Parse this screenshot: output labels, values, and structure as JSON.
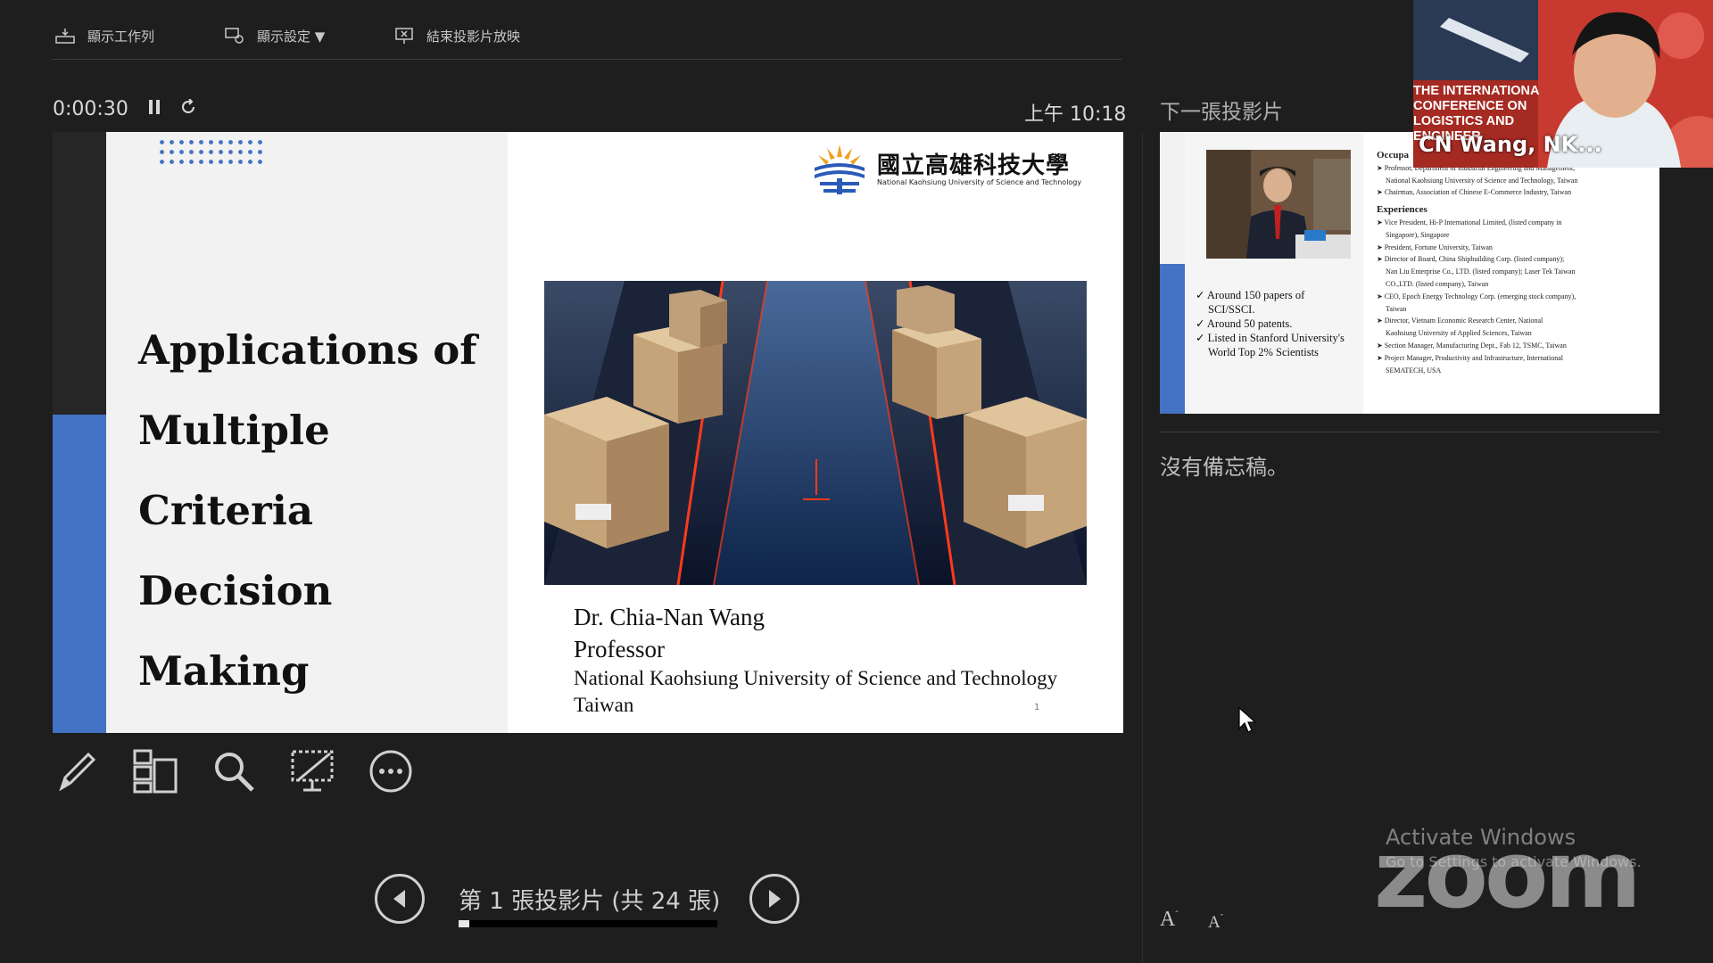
{
  "toolbar": {
    "show_taskbar": "顯示工作列",
    "display_settings": "顯示設定 ▼",
    "end_slideshow": "結束投影片放映"
  },
  "timer": {
    "elapsed": "0:00:30",
    "clock": "上午 10:18"
  },
  "next_slide_label": "下一張投影片",
  "current_slide": {
    "title_lines": [
      "Applications of",
      "Multiple Criteria",
      "Decision Making"
    ],
    "logo_zh": "國立高雄科技大學",
    "logo_en": "National Kaohsiung University of Science and Technology",
    "author": "Dr. Chia-Nan Wang",
    "position": "Professor",
    "university": "National Kaohsiung University of Science and Technology",
    "country": "Taiwan",
    "page": "1"
  },
  "next_slide": {
    "bullets": [
      "✓ Around 150 papers of",
      "SCI/SSCI.",
      "✓ Around 50 patents.",
      "✓ Listed in Stanford University's",
      "World Top 2% Scientists"
    ],
    "occupation_heading": "Occupa",
    "occupation_items": [
      "➤ Professor, Department of Industrial Engineering and Management,",
      "National Kaohsiung University of Science and Technology, Taiwan",
      "➤ Chairman, Association of Chinese E-Commerce Industry, Taiwan"
    ],
    "experiences_heading": "Experiences",
    "experience_items": [
      "➤ Vice President, Hi-P International Limited, (listed company in",
      "Singapore), Singapore",
      "➤ President, Fortune University, Taiwan",
      "➤ Director of Board, China Shipbuilding Corp. (listed company);",
      "Nan Liu Enterprise Co., LTD. (listed company); Laser Tek Taiwan",
      "CO.,LTD. (listed company), Taiwan",
      "➤ CEO, Epoch Energy Technology Corp. (emerging stock company),",
      "Taiwan",
      "➤ Director, Vietnam Economic Research Center, National",
      "Kaohsiung University of Applied Sciences, Taiwan",
      "➤ Section Manager, Manufacturing Dept., Fab 12, TSMC, Taiwan",
      "➤ Project Manager, Productivity and Infrastructure, International",
      "SEMATECH, USA"
    ]
  },
  "notes_text": "沒有備忘稿。",
  "navigation": {
    "counter": "第 1 張投影片 (共 24 張)",
    "current": 1,
    "total": 24,
    "progress_fraction": 0.0417
  },
  "video": {
    "participant_name": "CN Wang, NK...",
    "banner_lines": [
      "THE INTERNATIONA",
      "CONFERENCE ON",
      "LOGISTICS AND",
      "ENGINEER"
    ]
  },
  "font_buttons": {
    "increase": "A",
    "decrease": "A"
  },
  "watermark": {
    "line1": "Activate Windows",
    "line2": "Go to Settings to activate Windows."
  },
  "brand": {
    "logo_text": "zoom"
  },
  "colors": {
    "accent_blue": "#4472c4",
    "background": "#1e1e1e"
  },
  "icons": [
    "taskbar-icon",
    "display-settings-icon",
    "end-slideshow-icon",
    "pause-icon",
    "reset-icon",
    "pen-icon",
    "all-slides-icon",
    "zoom-magnifier-icon",
    "black-screen-icon",
    "more-options-icon",
    "prev-arrow-icon",
    "next-arrow-icon"
  ]
}
